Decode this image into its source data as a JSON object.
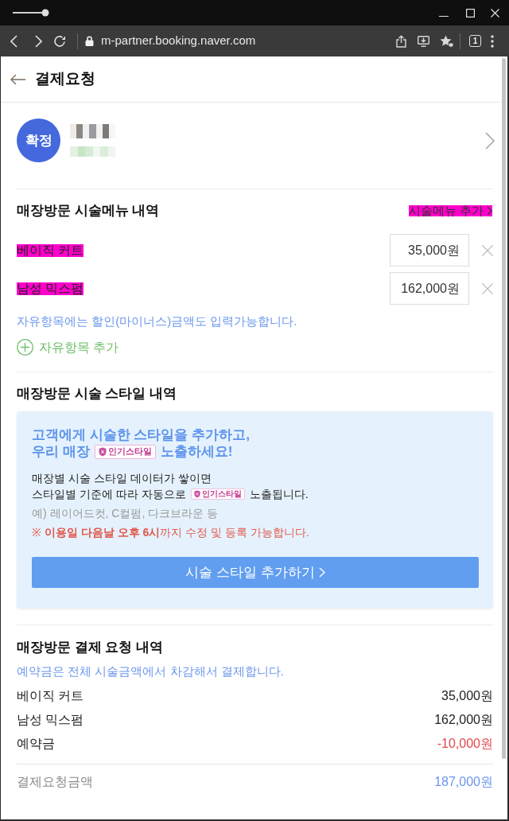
{
  "browser": {
    "url": "m-partner.booking.naver.com",
    "tab_count": "1"
  },
  "header": {
    "title": "결제요청"
  },
  "reservation": {
    "status": "확정"
  },
  "menu_section": {
    "title": "매장방문 시술메뉴 내역",
    "add_link": {
      "label": "시술메뉴 추가",
      "highlighted": true
    },
    "items": [
      {
        "name": "베이직 커트",
        "price": "35,000원",
        "highlighted": true
      },
      {
        "name": "남성 믹스펌",
        "price": "162,000원",
        "highlighted": true
      }
    ],
    "note": "자유항목에는 할인(마이너스)금액도 입력가능합니다.",
    "add_custom_label": "자유항목 추가"
  },
  "style_section": {
    "title": "매장방문 시술 스타일 내역",
    "promo": {
      "headline": [
        [
          {
            "kind": "text",
            "text": "고객에게 시술한 스타일을 추가하고,"
          }
        ],
        [
          {
            "kind": "text",
            "text": "우리 매장"
          },
          {
            "kind": "badge",
            "text": "인기스타일"
          },
          {
            "kind": "text",
            "text": "노출하세요!"
          }
        ]
      ],
      "body": [
        [
          {
            "kind": "text",
            "text": "매장별 시술 스타일 데이터가 쌓이면"
          }
        ],
        [
          {
            "kind": "text",
            "text": "스타일별 기준에 따라 자동으로"
          },
          {
            "kind": "badge",
            "text": "인기스타일"
          },
          {
            "kind": "text",
            "text": "노출됩니다."
          }
        ]
      ],
      "example": "예) 레이어드컷, C컬펌, 다크브라운 등",
      "notice": "※ **이용일 다음날 오후 6시**까지 수정 및 등록 가능합니다.",
      "button": "시술 스타일 추가하기"
    }
  },
  "payment_section": {
    "title": "매장방문 결제 요청 내역",
    "note": "예약금은 전체 시술금액에서 차감해서 결제합니다.",
    "rows": [
      {
        "name": "베이직 커트",
        "amount": "35,000원",
        "kind": "item"
      },
      {
        "name": "남성 믹스펌",
        "amount": "162,000원",
        "kind": "item"
      },
      {
        "name": "예약금",
        "amount": "-10,000원",
        "kind": "deposit"
      }
    ],
    "total": {
      "label": "결제요청금액",
      "amount": "187,000원"
    }
  }
}
